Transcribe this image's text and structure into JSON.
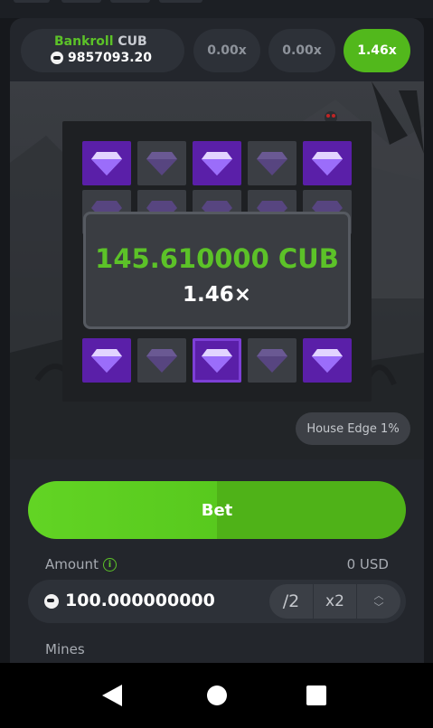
{
  "header": {
    "bankroll_label": "Bankroll",
    "bankroll_currency": "CUB",
    "bankroll_value": "9857093.20",
    "multipliers": [
      "0.00x",
      "0.00x",
      "1.46x"
    ],
    "active_multiplier_index": 2
  },
  "board": {
    "rows": [
      [
        "gem-revealed",
        "gem-hidden",
        "gem-revealed",
        "gem-hidden",
        "gem-revealed"
      ],
      [
        "gem-hidden",
        "gem-hidden",
        "gem-hidden",
        "gem-hidden",
        "gem-hidden"
      ],
      [
        "covered",
        "covered",
        "covered",
        "covered",
        "covered"
      ],
      [
        "covered",
        "covered",
        "covered",
        "covered",
        "covered"
      ],
      [
        "gem-revealed",
        "gem-hidden",
        "gem-revealed",
        "gem-hidden",
        "gem-revealed"
      ]
    ],
    "accent_color": "#5a1fa8"
  },
  "result": {
    "amount": "145.610000 CUB",
    "multiplier": "1.46×"
  },
  "house_edge": "House Edge 1%",
  "bet": {
    "button_label": "Bet",
    "color": "#5cc228"
  },
  "amount": {
    "label": "Amount",
    "usd_value": "0 USD",
    "value": "100.000000000",
    "half_label": "/2",
    "double_label": "x2"
  },
  "mines": {
    "label": "Mines"
  }
}
